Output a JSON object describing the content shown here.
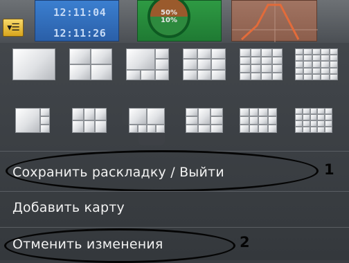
{
  "top_strip": {
    "menu_button_icon": "menu-icon",
    "clock_times": [
      "12:11:04",
      "12:11:26"
    ],
    "gauge_values": [
      "50%",
      "10%"
    ],
    "chart_tile_icon": "line-chart-icon"
  },
  "layout_rows": [
    {
      "layouts": [
        "1x1",
        "2x2",
        "1+5",
        "3x3",
        "4x4",
        "5x5"
      ]
    },
    {
      "layouts": [
        "1+7",
        "3x3 wide",
        "2+8",
        "1+12",
        "4x4 wide",
        "5x5 wide"
      ]
    }
  ],
  "menu": {
    "items": [
      {
        "label": "Сохранить раскладку / Выйти",
        "callout": "1"
      },
      {
        "label": "Добавить карту",
        "callout": ""
      },
      {
        "label": "Отменить изменения",
        "callout": "2"
      }
    ]
  },
  "colors": {
    "accent": "#e6b43a",
    "clock_tile": "#2f6fc0",
    "gauge_tile": "#2a8d3f",
    "chart_tile": "#946655",
    "menu_bg": "#3c4045",
    "menu_text": "#f2f2f2"
  }
}
